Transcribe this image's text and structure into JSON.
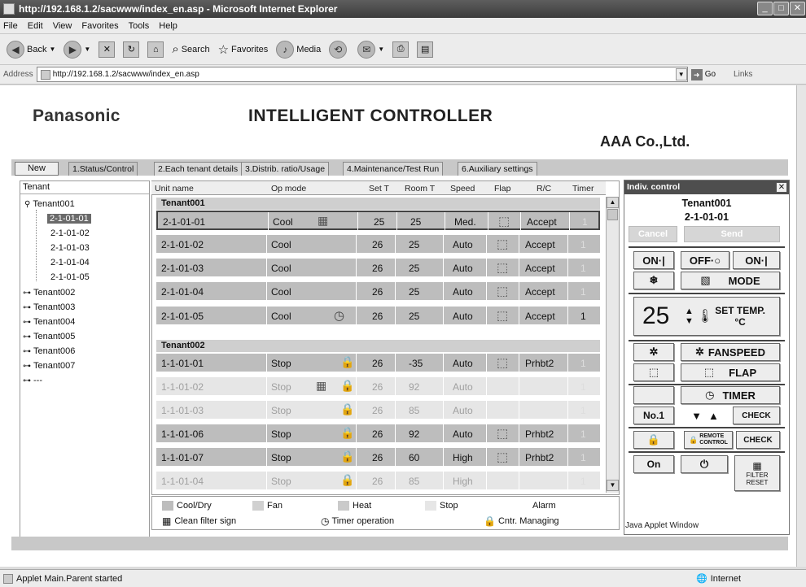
{
  "window": {
    "title": "http://192.168.1.2/sacwww/index_en.asp - Microsoft Internet Explorer"
  },
  "menu": [
    "File",
    "Edit",
    "View",
    "Favorites",
    "Tools",
    "Help"
  ],
  "toolbar": {
    "back": "Back",
    "search": "Search",
    "favorites": "Favorites",
    "media": "Media"
  },
  "address": {
    "label": "Address",
    "url": "http://192.168.1.2/sacwww/index_en.asp",
    "go": "Go",
    "links": "Links"
  },
  "page": {
    "brand": "Panasonic",
    "title": "INTELLIGENT CONTROLLER",
    "company": "AAA Co.,Ltd."
  },
  "tabs": {
    "new": "New",
    "items": [
      "1.Status/Control",
      "2.Each tenant details",
      "3.Distrib. ratio/Usage",
      "4.Maintenance/Test Run",
      "6.Auxiliary settings"
    ]
  },
  "tree": {
    "header": "Tenant",
    "t1": "Tenant001",
    "units": [
      "2-1-01-01",
      "2-1-01-02",
      "2-1-01-03",
      "2-1-01-04",
      "2-1-01-05"
    ],
    "others": [
      "Tenant002",
      "Tenant003",
      "Tenant004",
      "Tenant005",
      "Tenant006",
      "Tenant007",
      "---"
    ]
  },
  "table": {
    "headers": [
      "Unit name",
      "Op mode",
      "Set T",
      "Room T",
      "Speed",
      "Flap",
      "R/C",
      "Timer"
    ],
    "group1": "Tenant001",
    "group2": "Tenant002",
    "rows": [
      {
        "unit": "2-1-01-01",
        "mode": "Cool",
        "set": "25",
        "room": "25",
        "speed": "Med.",
        "rc": "Accept",
        "timer": "1"
      },
      {
        "unit": "2-1-01-02",
        "mode": "Cool",
        "set": "26",
        "room": "25",
        "speed": "Auto",
        "rc": "Accept",
        "timer": "1"
      },
      {
        "unit": "2-1-01-03",
        "mode": "Cool",
        "set": "26",
        "room": "25",
        "speed": "Auto",
        "rc": "Accept",
        "timer": "1"
      },
      {
        "unit": "2-1-01-04",
        "mode": "Cool",
        "set": "26",
        "room": "25",
        "speed": "Auto",
        "rc": "Accept",
        "timer": "1"
      },
      {
        "unit": "2-1-01-05",
        "mode": "Cool",
        "set": "26",
        "room": "25",
        "speed": "Auto",
        "rc": "Accept",
        "timer": "1"
      },
      {
        "unit": "1-1-01-01",
        "mode": "Stop",
        "set": "26",
        "room": "-35",
        "speed": "Auto",
        "rc": "Prhbt2",
        "timer": "1"
      },
      {
        "unit": "1-1-01-02",
        "mode": "Stop",
        "set": "26",
        "room": "92",
        "speed": "Auto",
        "rc": "",
        "timer": "1"
      },
      {
        "unit": "1-1-01-03",
        "mode": "Stop",
        "set": "26",
        "room": "85",
        "speed": "Auto",
        "rc": "",
        "timer": "1"
      },
      {
        "unit": "1-1-01-06",
        "mode": "Stop",
        "set": "26",
        "room": "92",
        "speed": "Auto",
        "rc": "Prhbt2",
        "timer": "1"
      },
      {
        "unit": "1-1-01-07",
        "mode": "Stop",
        "set": "26",
        "room": "60",
        "speed": "High",
        "rc": "Prhbt2",
        "timer": "1"
      },
      {
        "unit": "1-1-01-04",
        "mode": "Stop",
        "set": "26",
        "room": "85",
        "speed": "High",
        "rc": "",
        "timer": "1"
      }
    ]
  },
  "legend": {
    "cool": "Cool/Dry",
    "fan": "Fan",
    "heat": "Heat",
    "stop": "Stop",
    "alarm": "Alarm",
    "filter": "Clean filter sign",
    "timer": "Timer operation",
    "managing": "Cntr. Managing"
  },
  "panel": {
    "title": "Indiv. control",
    "tenant": "Tenant001",
    "unit": "2-1-01-01",
    "cancel": "Cancel",
    "send": "Send",
    "on1": "ON·|",
    "off": "OFF·○",
    "on2": "ON·|",
    "mode": "MODE",
    "temp": "25",
    "settemp1": "SET TEMP.",
    "settemp2": "°C",
    "fanspeed": "FANSPEED",
    "flap": "FLAP",
    "timer": "TIMER",
    "no1": "No.1",
    "check": "CHECK",
    "remote1": "REMOTE",
    "remote2": "CONTROL",
    "check2": "CHECK",
    "on": "On",
    "filter1": "FILTER",
    "filter2": "RESET",
    "applet": "Java Applet Window"
  },
  "status": {
    "left": "Applet Main.Parent started",
    "zone": "Internet"
  }
}
